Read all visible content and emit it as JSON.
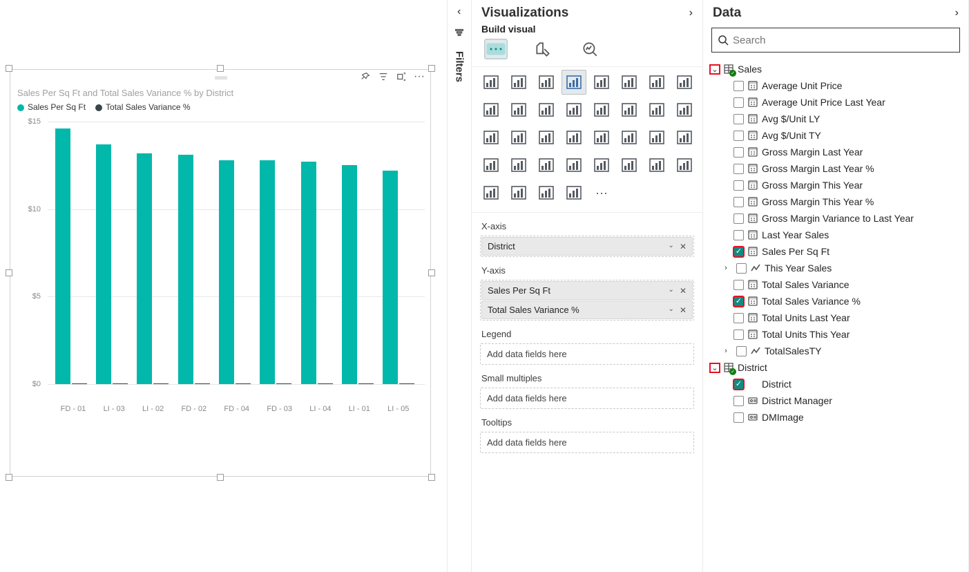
{
  "chart_data": {
    "type": "bar",
    "title": "Sales Per Sq Ft and Total Sales Variance % by District",
    "series": [
      {
        "name": "Sales Per Sq Ft",
        "color": "#01B8AA"
      },
      {
        "name": "Total Sales Variance %",
        "color": "#374649"
      }
    ],
    "categories": [
      "FD - 01",
      "LI - 03",
      "LI - 02",
      "FD - 02",
      "FD - 04",
      "FD - 03",
      "LI - 04",
      "LI - 01",
      "LI - 05"
    ],
    "values_series1": [
      14.6,
      13.7,
      13.2,
      13.1,
      12.8,
      12.8,
      12.7,
      12.5,
      12.2
    ],
    "values_series2": [
      0.05,
      0.05,
      0.05,
      0.05,
      0.05,
      0.05,
      0.05,
      0.05,
      0.05
    ],
    "y_ticks": [
      "$0",
      "$5",
      "$10",
      "$15"
    ],
    "y_max": 15
  },
  "filters": {
    "label": "Filters"
  },
  "viz_pane": {
    "title": "Visualizations",
    "subtitle": "Build visual",
    "icons": [
      "stacked-bar",
      "clustered-bar",
      "stacked-bar-h",
      "clustered-col",
      "stacked-col",
      "stacked-100",
      "line",
      "area",
      "stacked-area",
      "line-stacked",
      "line-clustered",
      "ribbon",
      "waterfall",
      "funnel",
      "scatter",
      "pie",
      "donut",
      "treemap",
      "map",
      "filled-map",
      "azure-map",
      "gauge",
      "card",
      "multi-card",
      "kpi",
      "slicer",
      "table",
      "matrix",
      "r-visual",
      "py-visual",
      "key-influencers",
      "decomp",
      "qa",
      "paginated",
      "power-apps",
      "power-automate",
      "more"
    ],
    "selected_icon_index": 3,
    "wells": {
      "xaxis": {
        "label": "X-axis",
        "pills": [
          "District"
        ]
      },
      "yaxis": {
        "label": "Y-axis",
        "pills": [
          "Sales Per Sq Ft",
          "Total Sales Variance %"
        ]
      },
      "legend": {
        "label": "Legend",
        "placeholder": "Add data fields here"
      },
      "small_multiples": {
        "label": "Small multiples",
        "placeholder": "Add data fields here"
      },
      "tooltips": {
        "label": "Tooltips",
        "placeholder": "Add data fields here"
      }
    }
  },
  "data_pane": {
    "title": "Data",
    "search_placeholder": "Search",
    "tables": [
      {
        "name": "Sales",
        "expanded": true,
        "fields": [
          {
            "name": "Average Unit Price",
            "type": "calc",
            "checked": false
          },
          {
            "name": "Average Unit Price Last Year",
            "type": "calc",
            "checked": false
          },
          {
            "name": "Avg $/Unit LY",
            "type": "calc",
            "checked": false
          },
          {
            "name": "Avg $/Unit TY",
            "type": "calc",
            "checked": false
          },
          {
            "name": "Gross Margin Last Year",
            "type": "calc",
            "checked": false
          },
          {
            "name": "Gross Margin Last Year %",
            "type": "calc",
            "checked": false
          },
          {
            "name": "Gross Margin This Year",
            "type": "calc",
            "checked": false
          },
          {
            "name": "Gross Margin This Year %",
            "type": "calc",
            "checked": false
          },
          {
            "name": "Gross Margin Variance to Last Year",
            "type": "calc",
            "checked": false
          },
          {
            "name": "Last Year Sales",
            "type": "calc",
            "checked": false
          },
          {
            "name": "Sales Per Sq Ft",
            "type": "calc",
            "checked": true,
            "highlight": true
          },
          {
            "name": "This Year Sales",
            "type": "hierarchy",
            "checked": false,
            "expandable": true
          },
          {
            "name": "Total Sales Variance",
            "type": "calc",
            "checked": false
          },
          {
            "name": "Total Sales Variance %",
            "type": "calc",
            "checked": true,
            "highlight": true
          },
          {
            "name": "Total Units Last Year",
            "type": "calc",
            "checked": false
          },
          {
            "name": "Total Units This Year",
            "type": "calc",
            "checked": false
          },
          {
            "name": "TotalSalesTY",
            "type": "hierarchy",
            "checked": false,
            "expandable": true
          }
        ]
      },
      {
        "name": "District",
        "expanded": true,
        "fields": [
          {
            "name": "District",
            "type": "col",
            "checked": true,
            "highlight": true
          },
          {
            "name": "District Manager",
            "type": "id",
            "checked": false
          },
          {
            "name": "DMImage",
            "type": "id",
            "checked": false
          }
        ]
      }
    ]
  }
}
